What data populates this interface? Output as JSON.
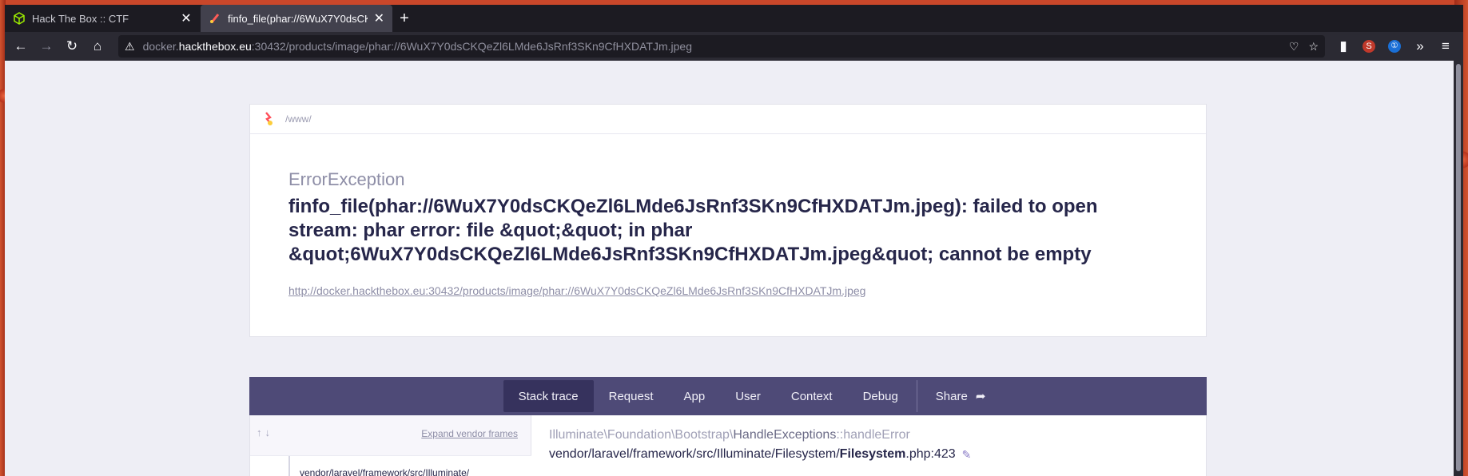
{
  "browser": {
    "tabs": [
      {
        "title": "Hack The Box :: CTF",
        "active": false
      },
      {
        "title": "finfo_file(phar://6WuX7Y0dsCKQeZl6LMde6JsRnf3SKn9CfHXDATJm.jpeg)",
        "active": true
      }
    ],
    "url": {
      "prefix": "docker.",
      "host": "hackthebox.eu",
      "rest": ":30432/products/image/phar://6WuX7Y0dsCKQeZl6LMde6JsRnf3SKn9CfHXDATJm.jpeg"
    }
  },
  "error_page": {
    "crumb": "/www/",
    "exception_class": "ErrorException",
    "message": "finfo_file(phar://6WuX7Y0dsCKQeZl6LMde6JsRnf3SKn9CfHXDATJm.jpeg): failed to open stream: phar error: file &quot;&quot; in phar &quot;6WuX7Y0dsCKQeZl6LMde6JsRnf3SKn9CfHXDATJm.jpeg&quot; cannot be empty",
    "request_url": "http://docker.hackthebox.eu:30432/products/image/phar://6WuX7Y0dsCKQeZl6LMde6JsRnf3SKn9CfHXDATJm.jpeg",
    "nav": [
      "Stack trace",
      "Request",
      "App",
      "User",
      "Context",
      "Debug"
    ],
    "share_label": "Share",
    "expand_vendor_label": "Expand vendor frames",
    "frame_path": "vendor/laravel/framework/src/Illuminate/",
    "trace_class_prefix": "Illuminate\\Foundation\\Bootstrap\\",
    "trace_class_name": "HandleExceptions",
    "trace_method": "::handleError",
    "trace_file_prefix": "vendor/laravel/framework/src/Illuminate/Filesystem/",
    "trace_file_name": "Filesystem",
    "trace_file_suffix": ".php:423"
  },
  "colors": {
    "nav_bg": "#4e4a77",
    "nav_active": "#36325d",
    "page_bg": "#eeeef5",
    "text_dark": "#26264a"
  }
}
